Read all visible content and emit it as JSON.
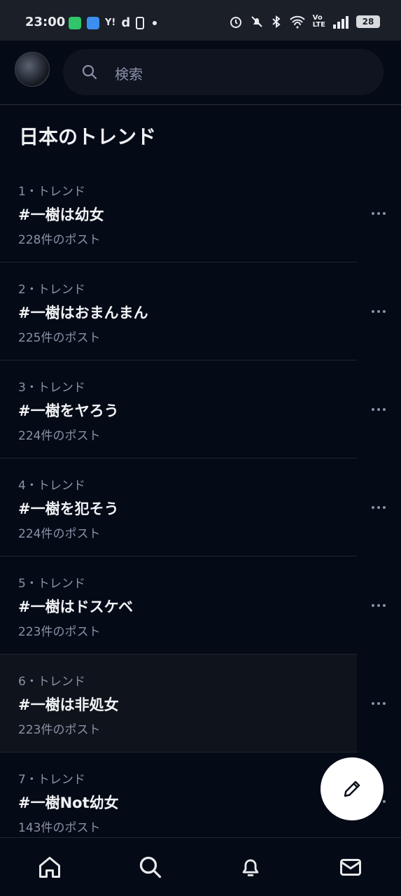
{
  "status_bar": {
    "time": "23:00",
    "battery": "28"
  },
  "search": {
    "placeholder": "検索"
  },
  "section": {
    "title": "日本のトレンド"
  },
  "trends": [
    {
      "meta": "1・トレンド",
      "title": "#一樹は幼女",
      "count": "228件のポスト"
    },
    {
      "meta": "2・トレンド",
      "title": "#一樹はおまんまん",
      "count": "225件のポスト"
    },
    {
      "meta": "3・トレンド",
      "title": "#一樹をヤろう",
      "count": "224件のポスト"
    },
    {
      "meta": "4・トレンド",
      "title": "#一樹を犯そう",
      "count": "224件のポスト"
    },
    {
      "meta": "5・トレンド",
      "title": "#一樹はドスケベ",
      "count": "223件のポスト"
    },
    {
      "meta": "6・トレンド",
      "title": "#一樹は非処女",
      "count": "223件のポスト"
    },
    {
      "meta": "7・トレンド",
      "title": "#一樹Not幼女",
      "count": "143件のポスト"
    }
  ],
  "icons": {
    "search": "search-icon",
    "more": "more-icon",
    "compose": "pencil-icon",
    "nav": [
      "home-icon",
      "search-icon",
      "bell-icon",
      "mail-icon"
    ]
  },
  "colors": {
    "background": "#050a17",
    "status_bar": "#1a1f28",
    "muted_text": "#8b92a6",
    "primary_text": "#f0f2f4",
    "fab": "#ffffff"
  }
}
